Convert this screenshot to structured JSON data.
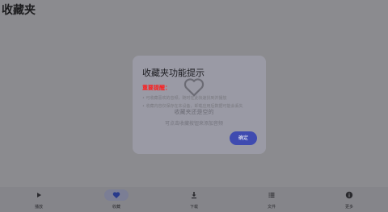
{
  "page": {
    "title": "收藏夹"
  },
  "empty": {
    "title": "收藏夹还是空的",
    "hint": "可点击收藏按钮来添加音频"
  },
  "dialog": {
    "title": "收藏夹功能提示",
    "note": "重要提醒：",
    "lines": [
      "• 可收藏喜欢的音频，随时在此快速找到并播放",
      "• 收藏内容仅保存在本设备，卸载应用后数据可能会丢失"
    ],
    "confirm": "确定"
  },
  "nav": {
    "items": [
      {
        "label": "播放",
        "icon": "play-icon"
      },
      {
        "label": "收藏",
        "icon": "heart-icon",
        "active": true
      },
      {
        "label": "下载",
        "icon": "download-icon"
      },
      {
        "label": "文件",
        "icon": "list-icon"
      },
      {
        "label": "更多",
        "icon": "info-icon"
      }
    ]
  },
  "colors": {
    "accent": "#3f4bb0",
    "warning": "#ff1a1a",
    "nav_active": "#283a8c"
  }
}
